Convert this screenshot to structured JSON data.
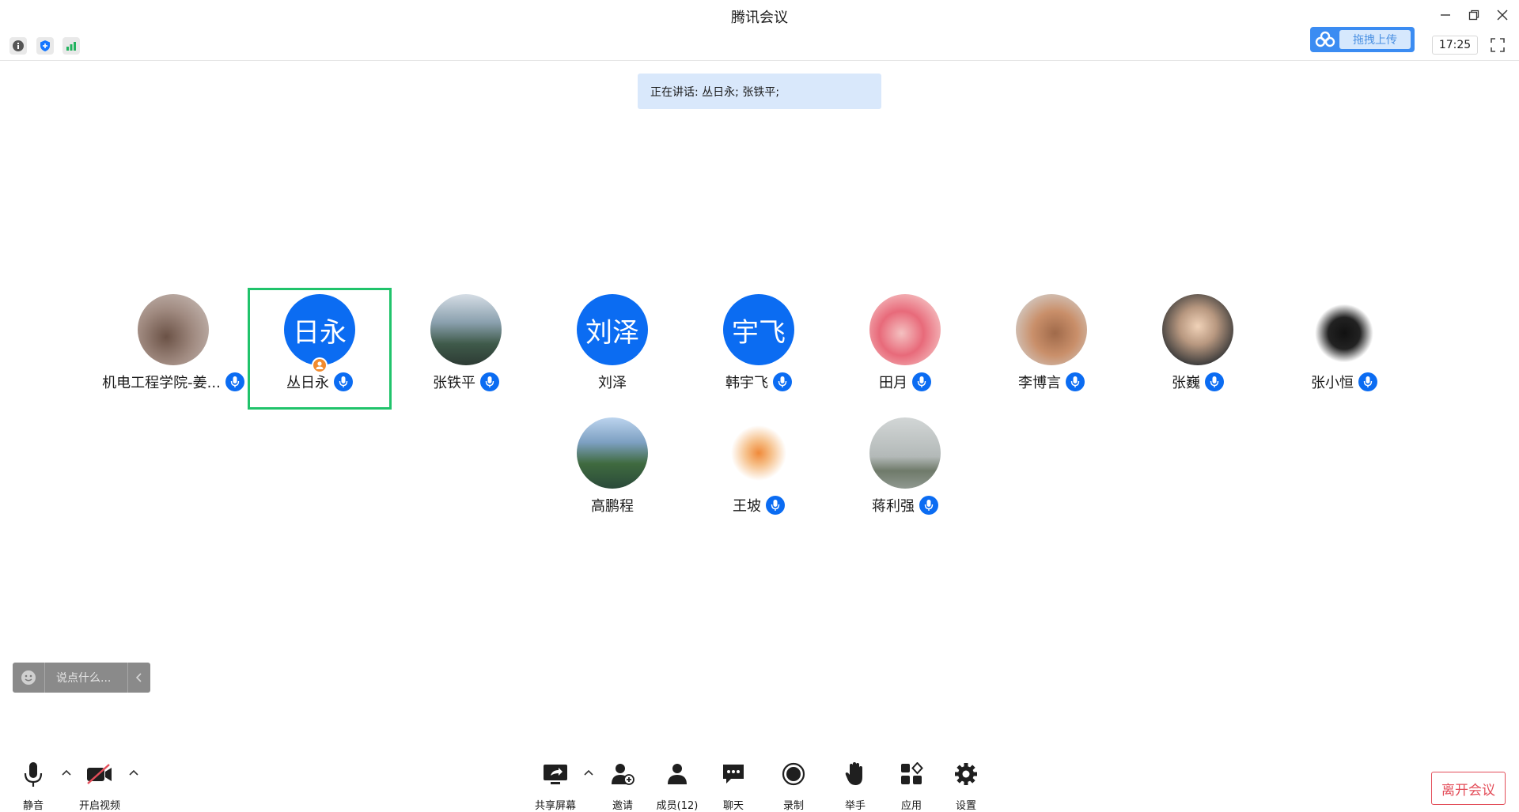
{
  "window": {
    "title": "腾讯会议",
    "controls": [
      "minimize-icon",
      "restore-icon",
      "close-icon"
    ]
  },
  "top_toolbar": {
    "icons": [
      "info-icon",
      "shield-icon",
      "signal-icon"
    ],
    "upload_label": "拖拽上传",
    "clock": "17:25"
  },
  "speaking_banner": "正在讲话: 丛日永; 张铁平;",
  "participants": [
    {
      "name": "机电工程学院-姜...",
      "avatar_type": "photo",
      "mic": true
    },
    {
      "name": "丛日永",
      "avatar_type": "text",
      "avatar_text": "日永",
      "mic": true,
      "host": true,
      "active": true
    },
    {
      "name": "张铁平",
      "avatar_type": "photo",
      "mic": true
    },
    {
      "name": "刘泽",
      "avatar_type": "text",
      "avatar_text": "刘泽",
      "mic": false
    },
    {
      "name": "韩宇飞",
      "avatar_type": "text",
      "avatar_text": "宇飞",
      "mic": true
    },
    {
      "name": "田月",
      "avatar_type": "photo",
      "mic": true
    },
    {
      "name": "李博言",
      "avatar_type": "photo",
      "mic": true
    },
    {
      "name": "张巍",
      "avatar_type": "photo",
      "mic": true
    },
    {
      "name": "张小恒",
      "avatar_type": "photo",
      "mic": true
    },
    {
      "name": "高鹏程",
      "avatar_type": "photo",
      "mic": false
    },
    {
      "name": "王坡",
      "avatar_type": "photo",
      "mic": true
    },
    {
      "name": "蒋利强",
      "avatar_type": "photo",
      "mic": true
    }
  ],
  "chat": {
    "placeholder": "说点什么..."
  },
  "bottom_bar": {
    "mute": "静音",
    "video": "开启视频",
    "share": "共享屏幕",
    "invite": "邀请",
    "members": "成员(12)",
    "chat": "聊天",
    "record": "录制",
    "raise_hand": "举手",
    "apps": "应用",
    "settings": "设置",
    "leave": "离开会议"
  },
  "colors": {
    "accent": "#0b6cf2",
    "active_speaker": "#20c36b",
    "leave": "#e34d59",
    "banner": "#d9e8fb"
  }
}
